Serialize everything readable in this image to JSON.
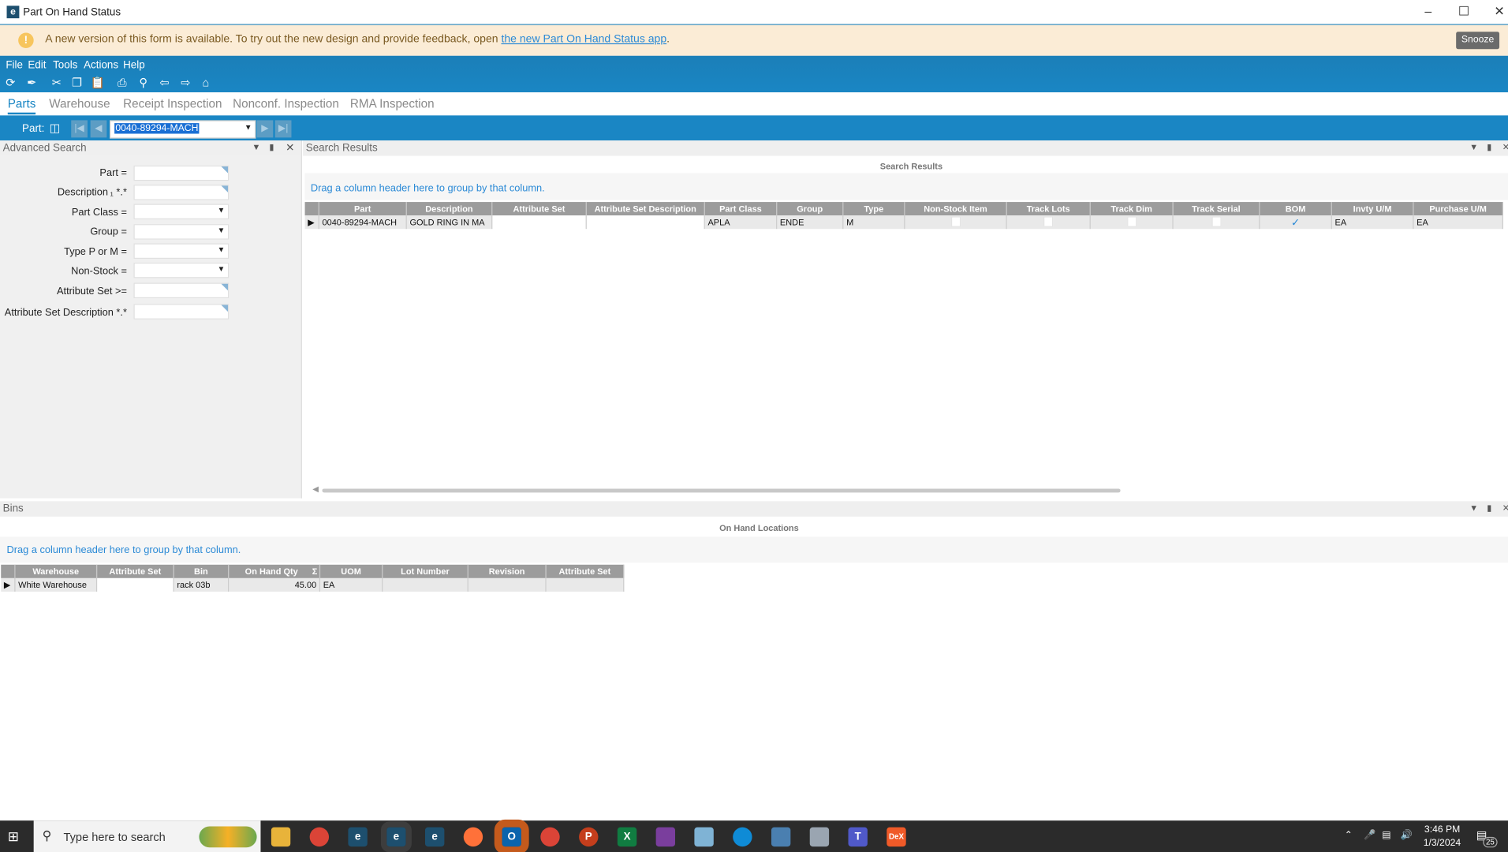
{
  "window": {
    "title": "Part On Hand Status",
    "logo_letter": "e"
  },
  "banner": {
    "message": "A new version of this form is available. To try out the new design and provide feedback, open ",
    "link": "the new Part On Hand Status app",
    "suffix": ".",
    "snooze": "Snooze"
  },
  "menu": [
    "File",
    "Edit",
    "Tools",
    "Actions",
    "Help"
  ],
  "tabs": [
    "Parts",
    "Warehouse",
    "Receipt Inspection",
    "Nonconf. Inspection",
    "RMA Inspection"
  ],
  "partbar": {
    "label": "Part:",
    "value": "0040-89294-MACH"
  },
  "advanced_search": {
    "title": "Advanced Search",
    "fields": [
      "Part =",
      "Description ₁ *.*",
      "Part Class =",
      "Group =",
      "Type P or  M =",
      "Non-Stock =",
      "Attribute Set >=",
      "Attribute Set Description *.*"
    ]
  },
  "search_results": {
    "title": "Search Results",
    "caption": "Search Results",
    "group_hint": "Drag a column header here to group by that column.",
    "columns": [
      "Part",
      "Description",
      "Attribute Set",
      "Attribute Set Description",
      "Part Class",
      "Group",
      "Type",
      "Non-Stock Item",
      "Track Lots",
      "Track Dim",
      "Track Serial",
      "BOM",
      "Invty U/M",
      "Purchase U/M"
    ],
    "rows": [
      {
        "part": "0040-89294-MACH",
        "description": "GOLD RING IN MA",
        "attribute_set": "",
        "attribute_set_description": "",
        "part_class": "APLA",
        "group": "ENDE",
        "type": "M",
        "non_stock": false,
        "track_lots": false,
        "track_dim": false,
        "track_serial": false,
        "bom": true,
        "invty_um": "EA",
        "purchase_um": "EA"
      }
    ]
  },
  "bins": {
    "title": "Bins",
    "caption": "On Hand Locations",
    "group_hint": "Drag a column header here to group by that column.",
    "columns": [
      "Warehouse",
      "Attribute Set",
      "Bin",
      "On Hand Qty",
      "UOM",
      "Lot Number",
      "Revision",
      "Attribute Set"
    ],
    "rows": [
      {
        "warehouse": "White Warehouse",
        "attribute_set": "",
        "bin": "rack 03b",
        "qty": "45.00",
        "uom": "EA",
        "lot": "",
        "revision": "",
        "attribute_set2": ""
      }
    ]
  },
  "taskbar": {
    "search_placeholder": "Type here to search",
    "time": "3:46 PM",
    "date": "1/3/2024",
    "notifications": "25",
    "dex": "DeX"
  }
}
